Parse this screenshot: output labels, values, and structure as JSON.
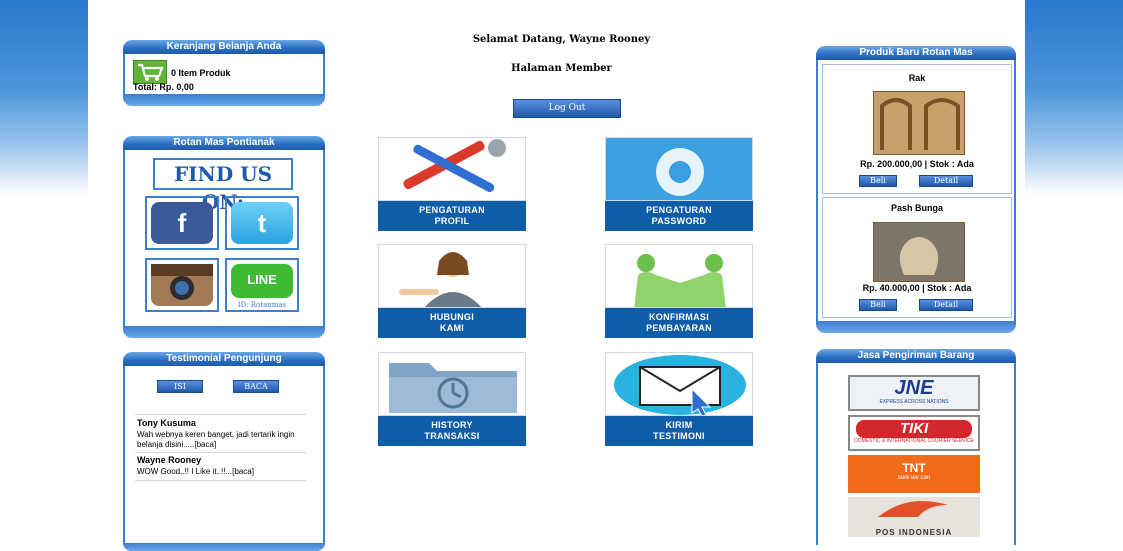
{
  "cart": {
    "title": "Keranjang Belanja Anda",
    "items_text": "0 Item Produk",
    "total_text": "Total: Rp. 0,00"
  },
  "social": {
    "title": "Rotan Mas Pontianak",
    "find_us": "FIND US ON:",
    "line_id": "ID: Rotanmas",
    "facebook_glyph": "f",
    "twitter_glyph": "t",
    "line_label": "LINE"
  },
  "testimonial": {
    "title": "Testimonial Pengunjung",
    "btn_isi": "ISI",
    "btn_baca": "BACA",
    "entries": [
      {
        "name": "Tony Kusuma",
        "message": "Wah webnya keren banget, jadi tertarik ingin belanja disini.....[baca]"
      },
      {
        "name": "Wayne Rooney",
        "message": "WOW Good..!! I Like it..!!...[baca]"
      }
    ]
  },
  "header": {
    "welcome": "Selamat Datang, Wayne Rooney",
    "page_title": "Halaman Member",
    "logout_label": "Log Out"
  },
  "menu": [
    {
      "line1": "Pengaturan",
      "line2": "Profil",
      "icon": "tools-icon"
    },
    {
      "line1": "Pengaturan",
      "line2": "Password",
      "icon": "gear-icon"
    },
    {
      "line1": "Hubungi",
      "line2": "Kami",
      "icon": "support-agent-icon"
    },
    {
      "line1": "Konfirmasi",
      "line2": "Pembayaran",
      "icon": "handshake-icon"
    },
    {
      "line1": "History",
      "line2": "Transaksi",
      "icon": "folder-clock-icon"
    },
    {
      "line1": "Kirim",
      "line2": "Testimoni",
      "icon": "mail-icon"
    }
  ],
  "products": {
    "title": "Produk Baru Rotan Mas",
    "items": [
      {
        "name": "Rak",
        "price": "Rp. 200.000,00 | Stok : Ada",
        "buy": "Beli",
        "detail": "Detail"
      },
      {
        "name": "Pash Bunga",
        "price": "Rp. 40.000,00 | Stok : Ada",
        "buy": "Beli",
        "detail": "Detail"
      }
    ]
  },
  "shipping": {
    "title": "Jasa Pengiriman Barang",
    "jne": "JNE",
    "jne_tag": "EXPRESS ACROSS NATIONS",
    "tiki": "TIKI",
    "tiki_tag": "DOMESTIC & INTERNATIONAL COURIER SERVICE",
    "tnt": "TNT",
    "tnt_tag": "sure we can",
    "pos": "POS INDONESIA"
  },
  "colors": {
    "accent": "#1f5aa8",
    "menu_caption": "#0f5ca8",
    "cart_green": "#62b33a"
  }
}
